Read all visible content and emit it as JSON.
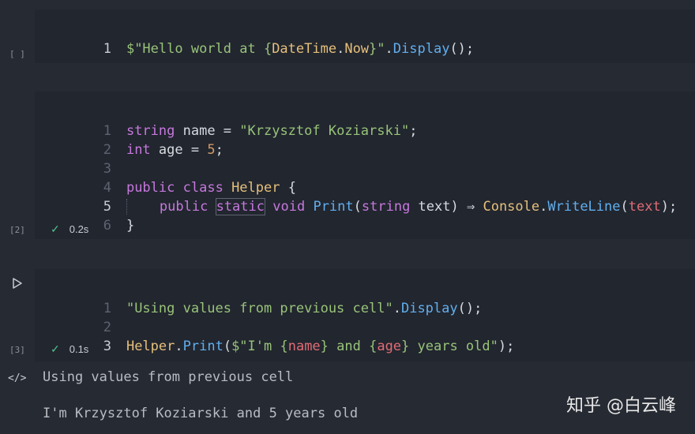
{
  "cells": [
    {
      "exec_label": "[ ]",
      "lines": [
        {
          "n": "1",
          "active": true
        }
      ]
    },
    {
      "exec_label": "[2]",
      "status_time": "0.2s",
      "lines": [
        {
          "n": "1"
        },
        {
          "n": "2"
        },
        {
          "n": "3"
        },
        {
          "n": "4"
        },
        {
          "n": "5",
          "active": true
        },
        {
          "n": "6"
        }
      ]
    },
    {
      "exec_label": "[3]",
      "status_time": "0.1s",
      "lines": [
        {
          "n": "1"
        },
        {
          "n": "2"
        },
        {
          "n": "3",
          "active": true
        }
      ]
    }
  ],
  "code": {
    "c1_l1_a": "$\"Hello world at {",
    "c1_l1_b": "DateTime",
    "c1_l1_c": ".",
    "c1_l1_d": "Now",
    "c1_l1_e": "}\"",
    "c1_l1_f": ".",
    "c1_l1_g": "Display",
    "c1_l1_h": "();",
    "c2_l1_a": "string",
    "c2_l1_b": " name = ",
    "c2_l1_c": "\"Krzysztof Koziarski\"",
    "c2_l1_d": ";",
    "c2_l2_a": "int",
    "c2_l2_b": " age = ",
    "c2_l2_c": "5",
    "c2_l2_d": ";",
    "c2_l4_a": "public",
    "c2_l4_b": " ",
    "c2_l4_c": "class",
    "c2_l4_d": " ",
    "c2_l4_e": "Helper",
    "c2_l4_f": " {",
    "c2_l5_a": "public",
    "c2_l5_b": "static",
    "c2_l5_c": "void",
    "c2_l5_d": "Print",
    "c2_l5_e": "(",
    "c2_l5_f": "string",
    "c2_l5_g": " text) ",
    "c2_l5_h": "⇒",
    "c2_l5_i": " ",
    "c2_l5_j": "Console",
    "c2_l5_k": ".",
    "c2_l5_l": "WriteLine",
    "c2_l5_m": "(",
    "c2_l5_n": "text",
    "c2_l5_o": ");",
    "c2_l6_a": "}",
    "c3_l1_a": "\"Using values from previous cell\"",
    "c3_l1_b": ".",
    "c3_l1_c": "Display",
    "c3_l1_d": "();",
    "c3_l3_a": "Helper",
    "c3_l3_b": ".",
    "c3_l3_c": "Print",
    "c3_l3_d": "(",
    "c3_l3_e": "$\"I'm {",
    "c3_l3_f": "name",
    "c3_l3_g": "} and {",
    "c3_l3_h": "age",
    "c3_l3_i": "} years old\"",
    "c3_l3_j": ");"
  },
  "output": {
    "line1": "Using values from previous cell",
    "line2": "I'm Krzysztof Koziarski and 5 years old"
  },
  "watermark": "知乎 @白云峰",
  "icons": {
    "run": "play-icon",
    "check": "check-icon",
    "output": "code-icon"
  },
  "colors": {
    "keyword": "#c678dd",
    "string": "#98c379",
    "number": "#d19a66",
    "class": "#e5c07b",
    "function": "#61afef",
    "success": "#4fc08d"
  }
}
